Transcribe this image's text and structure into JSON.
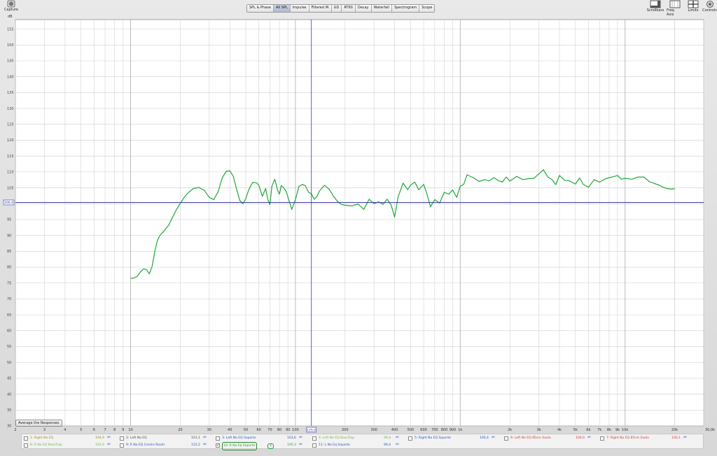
{
  "toolbar": {
    "capture_label": "Capture",
    "tabs": [
      "SPL & Phase",
      "All SPL",
      "Impulse",
      "Filtered IR",
      "GD",
      "RT60",
      "Decay",
      "Waterfall",
      "Spectrogram",
      "Scope"
    ],
    "active_tab": "All SPL",
    "right_buttons": [
      "Scrollbars",
      "Freq. Axis",
      "Limits",
      "Controls"
    ]
  },
  "chart_data": {
    "type": "line",
    "ylabel": "dB",
    "xscale": "log",
    "xlim": [
      2,
      30000
    ],
    "ylim": [
      30,
      158
    ],
    "y_ticks": [
      155,
      150,
      145,
      140,
      135,
      130,
      125,
      120,
      115,
      110,
      105,
      100,
      95,
      90,
      85,
      80,
      75,
      70,
      65,
      60,
      55,
      50,
      45,
      40,
      35,
      30
    ],
    "x_ticks": [
      2,
      3,
      4,
      5,
      6,
      7,
      8,
      9,
      10,
      20,
      30,
      40,
      50,
      60,
      70,
      80,
      90,
      100,
      200,
      300,
      400,
      500,
      600,
      700,
      800,
      900,
      1000,
      2000,
      3000,
      4000,
      5000,
      6000,
      7000,
      8000,
      9000,
      10000,
      20000
    ],
    "x_tick_labels": [
      "2",
      "3",
      "4",
      "5",
      "6",
      "7",
      "8",
      "9",
      "10",
      "20",
      "30",
      "40",
      "50",
      "60",
      "70",
      "80",
      "90",
      "100",
      "200",
      "300",
      "400",
      "500",
      "600",
      "700",
      "800",
      "900",
      "1k",
      "2k",
      "3k",
      "4k",
      "5k",
      "6k",
      "7k",
      "8k",
      "9k",
      "10k",
      "20k"
    ],
    "x_end_label": "30,0k",
    "grid": true,
    "cursor": {
      "x": 125,
      "y": 100.4,
      "x_readout": "125,5",
      "y_readout": "100,4"
    },
    "series": [
      {
        "name": "10: R No Eq Soporte",
        "color": "#21a63a",
        "x": [
          10,
          10.5,
          11,
          11.5,
          12,
          12.5,
          13,
          13.5,
          14,
          14.5,
          15,
          16,
          17,
          18,
          19,
          20,
          21,
          22,
          24,
          26,
          28,
          30,
          32,
          34,
          36,
          38,
          40,
          42,
          44,
          46,
          48,
          50,
          52,
          55,
          58,
          60,
          63,
          66,
          68,
          70,
          72,
          75,
          78,
          80,
          82,
          85,
          88,
          90,
          95,
          100,
          105,
          110,
          115,
          120,
          125,
          130,
          135,
          140,
          150,
          160,
          170,
          180,
          190,
          200,
          220,
          240,
          260,
          280,
          300,
          320,
          340,
          360,
          380,
          400,
          420,
          450,
          480,
          500,
          530,
          560,
          600,
          630,
          660,
          700,
          750,
          800,
          850,
          900,
          950,
          1000,
          1050,
          1100,
          1200,
          1300,
          1400,
          1500,
          1600,
          1700,
          1800,
          1900,
          2000,
          2200,
          2400,
          2600,
          2800,
          3000,
          3200,
          3400,
          3600,
          3800,
          4000,
          4300,
          4600,
          5000,
          5300,
          5600,
          6000,
          6500,
          7000,
          7500,
          8000,
          8500,
          9000,
          9500,
          10000,
          11000,
          12000,
          13000,
          14000,
          15000,
          16000,
          17000,
          18000,
          19000,
          20000
        ],
        "y": [
          76.5,
          76.6,
          77.2,
          78.6,
          79.5,
          79.2,
          77.9,
          80.2,
          84.8,
          88.2,
          89.9,
          91.5,
          93.2,
          95.8,
          98.2,
          100.1,
          101.8,
          103.1,
          104.8,
          105.1,
          104.2,
          102.0,
          101.3,
          103.8,
          108.2,
          110.2,
          110.4,
          108.6,
          104.5,
          101.0,
          100.0,
          101.6,
          104.3,
          106.7,
          106.6,
          105.8,
          102.3,
          104.8,
          101.3,
          99.7,
          105.5,
          107.7,
          104.2,
          103.0,
          105.7,
          105.0,
          103.8,
          102.2,
          98.2,
          101.3,
          105.4,
          106.1,
          105.6,
          103.6,
          103.1,
          101.4,
          102.2,
          104.0,
          105.8,
          104.6,
          102.4,
          100.7,
          99.8,
          99.5,
          99.3,
          99.9,
          98.2,
          101.4,
          100.0,
          100.6,
          99.8,
          101.4,
          99.7,
          95.8,
          102.2,
          106.5,
          104.4,
          105.9,
          106.8,
          104.4,
          106.1,
          102.8,
          99.0,
          101.3,
          100.2,
          103.6,
          103.0,
          104.3,
          102.0,
          105.5,
          106.1,
          109.1,
          108.2,
          107.0,
          107.6,
          107.2,
          108.2,
          107.3,
          106.8,
          108.4,
          107.1,
          108.6,
          107.6,
          107.9,
          108.0,
          109.4,
          110.7,
          108.4,
          107.6,
          106.0,
          108.9,
          107.4,
          107.2,
          106.2,
          108.1,
          106.0,
          105.2,
          107.6,
          106.8,
          107.7,
          108.2,
          108.5,
          108.9,
          107.7,
          108.0,
          107.7,
          108.4,
          108.4,
          107.0,
          106.4,
          105.9,
          105.2,
          104.8,
          104.6,
          104.7
        ]
      }
    ]
  },
  "avg_button": "Average the Responses",
  "legend": {
    "row1": [
      {
        "name": "1: Right No EQ",
        "value": "104,9",
        "unit": "dB",
        "checked": false,
        "color": "#9a8a1e"
      },
      {
        "name": "2: Left No EQ",
        "value": "101,1",
        "unit": "dB",
        "checked": false,
        "color": "#4d4d4d"
      },
      {
        "name": "3: Left No EQ Soporte",
        "value": "103,6",
        "unit": "dB",
        "checked": false,
        "color": "#2b53c9"
      },
      {
        "name": "4: Left No EQ BassTrap",
        "value": "99,4",
        "unit": "dB",
        "checked": false,
        "color": "#70b84a"
      },
      {
        "name": "5: Right No EQ Soporte",
        "value": "100,4",
        "unit": "dB",
        "checked": false,
        "color": "#2b53c9"
      },
      {
        "name": "6: Left No EQ 85cm Suelo",
        "value": "100,0",
        "unit": "dB",
        "checked": false,
        "color": "#d23a3a"
      },
      {
        "name": "7: Right No EQ 85cm Suelo",
        "value": "100,1",
        "unit": "dB",
        "checked": false,
        "color": "#d23a3a"
      }
    ],
    "row2": [
      {
        "name": "8: R No EQ BassTrap",
        "value": "103,9",
        "unit": "dB",
        "checked": false,
        "color": "#70b84a"
      },
      {
        "name": "9: R No EQ Centro Room",
        "value": "115,2",
        "unit": "dB",
        "checked": false,
        "color": "#2b53c9"
      },
      {
        "name": "10: R No Eq Soporte",
        "value": "105,3",
        "unit": "dB",
        "checked": true,
        "color": "#21a63a",
        "selected_mark": "V"
      },
      {
        "name": "11: L No Eq Soporte",
        "value": "99,4",
        "unit": "dB",
        "checked": false,
        "color": "#2b53c9"
      }
    ]
  }
}
